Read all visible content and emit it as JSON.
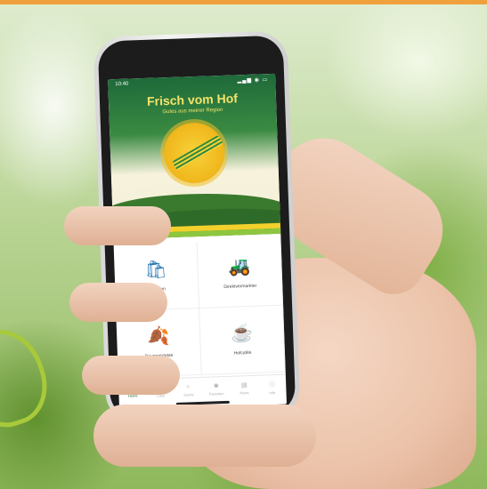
{
  "app": {
    "title": "Frisch vom Hof",
    "subtitle": "Gutes aus meiner Region",
    "status_time": "10:40",
    "status_icons": "▂▄▆ ◉ ▭"
  },
  "tiles": [
    {
      "label": "Hofladen",
      "icon": "shopping-bag-icon",
      "glyph": "🛍"
    },
    {
      "label": "Direktvermarkter",
      "icon": "tractor-icon",
      "glyph": "🚜"
    },
    {
      "label": "Bauernmärkte",
      "icon": "leaf-icon",
      "glyph": "🍂"
    },
    {
      "label": "Hofcafés",
      "icon": "coffee-cup-icon",
      "glyph": "☕"
    }
  ],
  "tabs": [
    {
      "label": "Home",
      "icon": "home-icon",
      "glyph": "⌂",
      "active": true
    },
    {
      "label": "Liste",
      "icon": "list-icon",
      "glyph": "☰",
      "active": false
    },
    {
      "label": "Suche",
      "icon": "search-icon",
      "glyph": "⌕",
      "active": false
    },
    {
      "label": "Favoriten",
      "icon": "star-icon",
      "glyph": "✱",
      "active": false
    },
    {
      "label": "News",
      "icon": "news-icon",
      "glyph": "▤",
      "active": false
    },
    {
      "label": "Info",
      "icon": "info-icon",
      "glyph": "ⓘ",
      "active": false
    }
  ],
  "colors": {
    "top_bar": "#f0a03c",
    "header_green": "#1e6a3a",
    "title_yellow": "#f5e36a",
    "active_tab": "#2e6b3a"
  }
}
